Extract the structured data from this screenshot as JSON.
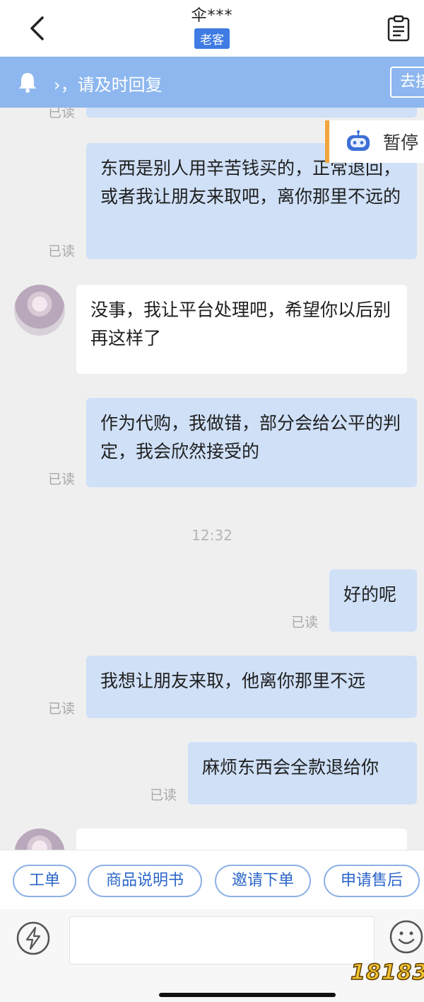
{
  "header": {
    "contact_name": "伞***",
    "contact_tag": "老客"
  },
  "notice": {
    "text": "›，请及时回复",
    "button": "去接"
  },
  "bot": {
    "label": "暂停"
  },
  "messages": [
    {
      "dir": "out",
      "read": "已读",
      "text": "东西是别人用辛苦钱买的，正常退回，或者我让朋友来取吧，离你那里不远的"
    },
    {
      "dir": "in",
      "text": "没事，我让平台处理吧，希望你以后别再这样了"
    },
    {
      "dir": "out",
      "read": "已读",
      "text": "作为代购，我做错，部分会给公平的判定，我会欣然接受的"
    },
    {
      "dir": "out",
      "read": "已读",
      "text": "好的呢"
    },
    {
      "dir": "out",
      "read": "已读",
      "text": "我想让朋友来取，他离你那里不远"
    },
    {
      "dir": "out",
      "read": "已读",
      "text": "麻烦东西会全款退给你"
    }
  ],
  "partial_read": "已读",
  "timestamp": "12:32",
  "quick_actions": [
    "工单",
    "商品说明书",
    "邀请下单",
    "申请售后"
  ],
  "watermark": "18183",
  "icons": {
    "back": "chevron-left-icon",
    "notes": "clipboard-icon",
    "bell": "bell-icon",
    "bot": "robot-icon",
    "quick_reply": "lightning-icon",
    "emoji": "smiley-icon"
  },
  "colors": {
    "accent": "#3f7be3",
    "notice_bg": "#8db7ee",
    "outgoing_bubble": "#cfe0f7",
    "incoming_bubble": "#ffffff",
    "bot_border": "#f0a63c"
  }
}
